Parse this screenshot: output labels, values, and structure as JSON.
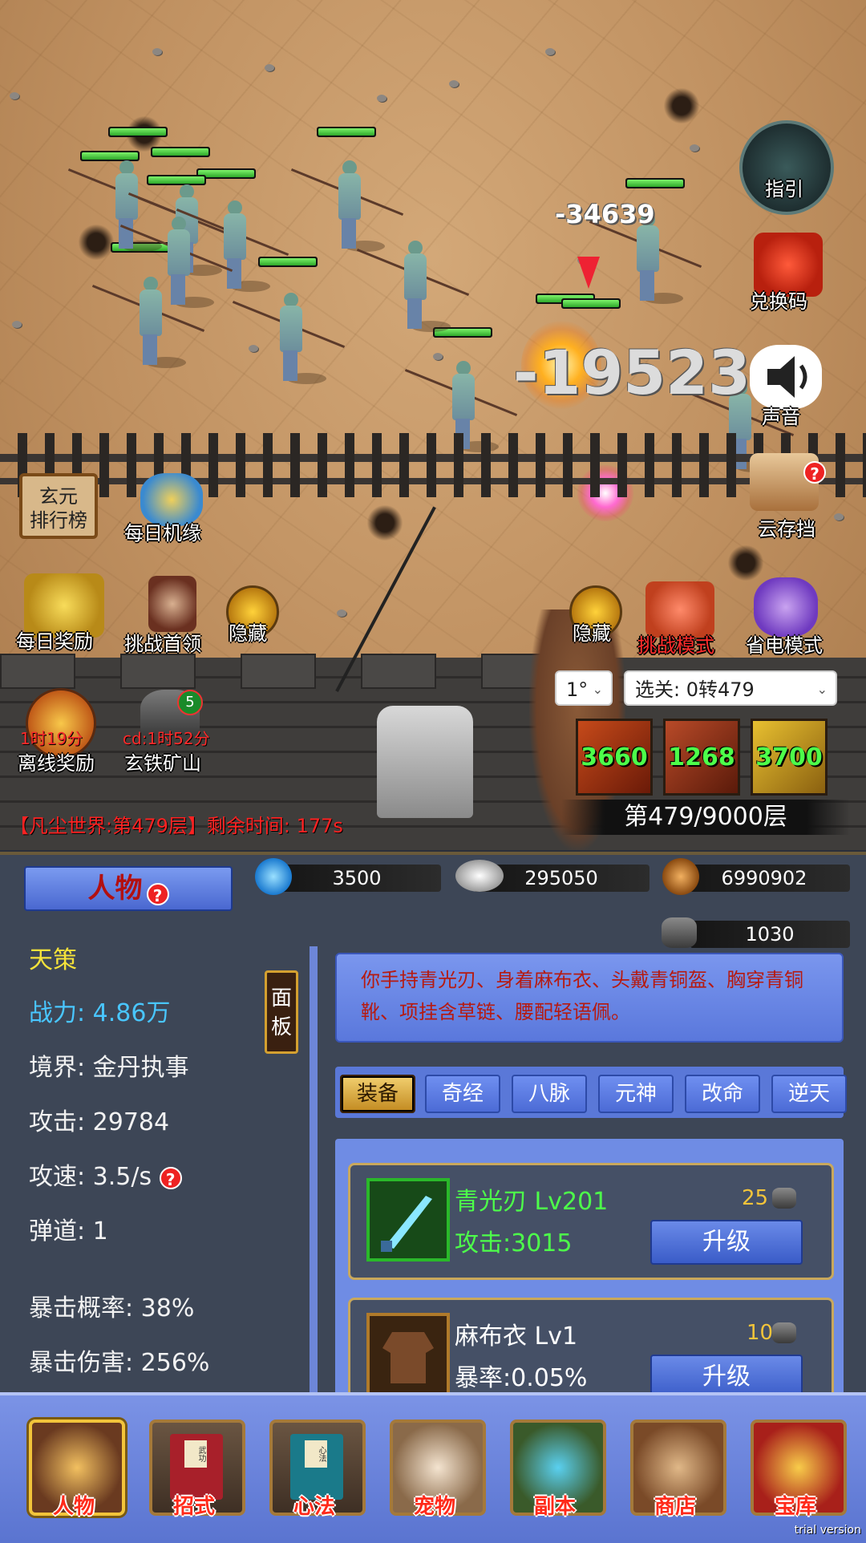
{
  "battle": {
    "damage_small": "-34639",
    "damage_big": "-195234",
    "stage_timer": "【凡尘世界:第479层】剩余时间: 177s",
    "floor": "第479/9000层"
  },
  "right_menu": {
    "guide": "指引",
    "redeem": "兑换码",
    "sound": "声音",
    "cloud_save": "云存挡",
    "power_save": "省电模式",
    "challenge_mode": "挑战模式",
    "hide_right": "隐藏"
  },
  "left_menu": {
    "ranking": "玄元\n排行榜",
    "daily_chance": "每日机缘",
    "daily_reward": "每日奖励",
    "challenge_boss": "挑战首领",
    "hide_left": "隐藏",
    "offline_reward": "离线奖励",
    "offline_timer": "1时19分",
    "iron_mine": "玄铁矿山",
    "iron_mine_cd": "cd:1时52分",
    "iron_mine_badge": "5"
  },
  "controls": {
    "speed_select": "1°",
    "stage_select": "选关: 0转479",
    "skills": [
      "3660",
      "1268",
      "3700"
    ]
  },
  "resources": {
    "spirit": "3500",
    "silver": "295050",
    "copper": "6990902",
    "ore": "1030"
  },
  "character": {
    "panel_title": "人物",
    "class_name": "天策",
    "power": "战力: 4.86万",
    "realm": "境界: 金丹执事",
    "attack": "攻击: 29784",
    "attack_speed": "攻速: 3.5/s",
    "projectiles": "弹道: 1",
    "crit_rate": "暴击概率: 38%",
    "crit_damage": "暴击伤害: 256%",
    "panel_button": "面\n板",
    "description": "你手持青光刃、身着麻布衣、头戴青铜盔、胸穿青铜靴、项挂含草链、腰配轻语佩。",
    "help_mark": "?"
  },
  "tabs": [
    "装备",
    "奇经",
    "八脉",
    "元神",
    "改命",
    "逆天"
  ],
  "equipment": [
    {
      "name": "青光刃 Lv201",
      "stat": "攻击:3015",
      "cost": "25",
      "button": "升级"
    },
    {
      "name": "麻布衣 Lv1",
      "stat": "暴率:0.05%",
      "cost": "10",
      "button": "升级"
    }
  ],
  "nav": [
    "人物",
    "招式",
    "心法",
    "宠物",
    "副本",
    "商店",
    "宝库"
  ],
  "nav_book_labels": [
    "武功",
    "心法"
  ],
  "watermark": "trial version",
  "colors": {
    "accent_blue": "#5a74d0",
    "gold": "#f2c43a",
    "green_text": "#4dff4a",
    "yellow_text": "#f5e23a",
    "cyan_text": "#49c6ff"
  }
}
